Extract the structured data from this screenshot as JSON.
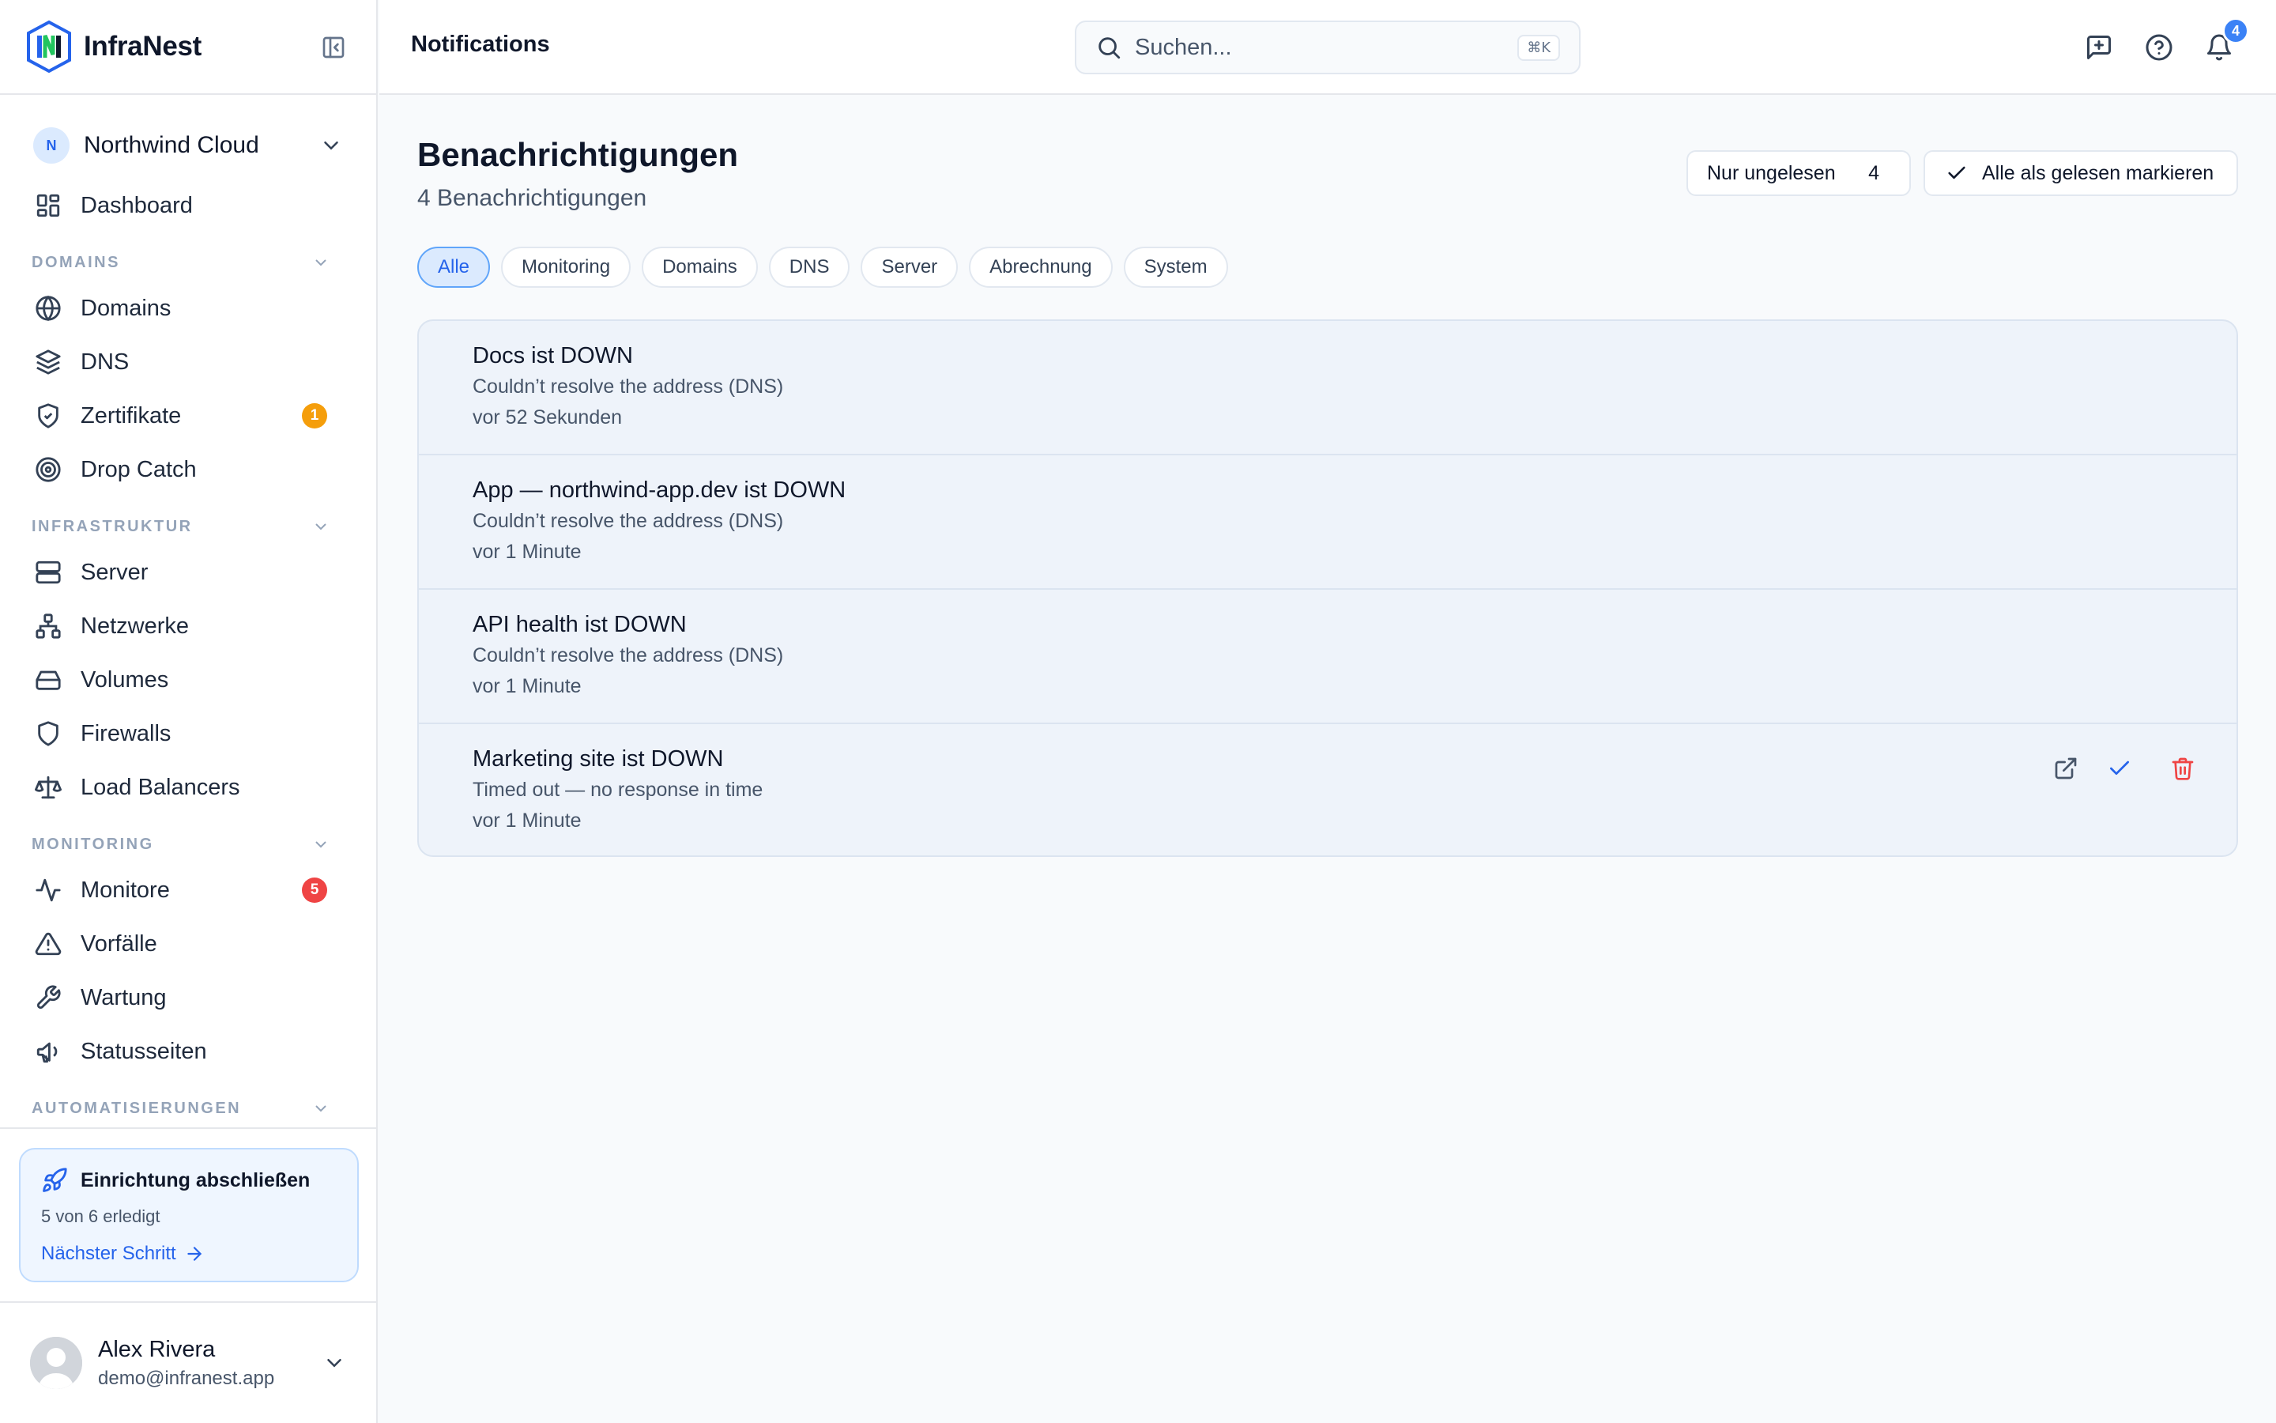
{
  "brand": {
    "name": "InfraNest"
  },
  "workspace": {
    "initial": "N",
    "name": "Northwind Cloud"
  },
  "nav": {
    "dashboard": "Dashboard",
    "sections": {
      "domains": "DOMAINS",
      "infrastructure": "INFRASTRUKTUR",
      "monitoring": "MONITORING",
      "automation": "AUTOMATISIERUNGEN"
    },
    "domains": {
      "domains": "Domains",
      "dns": "DNS",
      "certs": "Zertifikate",
      "certs_badge": "1",
      "dropcatch": "Drop Catch"
    },
    "infra": {
      "server": "Server",
      "networks": "Netzwerke",
      "volumes": "Volumes",
      "firewalls": "Firewalls",
      "lb": "Load Balancers"
    },
    "monitoring": {
      "monitors": "Monitore",
      "monitors_badge": "5",
      "incidents": "Vorfälle",
      "maintenance": "Wartung",
      "statuspages": "Statusseiten"
    }
  },
  "setup": {
    "title": "Einrichtung abschließen",
    "progress": "5 von 6 erledigt",
    "next": "Nächster Schritt"
  },
  "user": {
    "name": "Alex Rivera",
    "email": "demo@infranest.app"
  },
  "topbar": {
    "title": "Notifications",
    "search_placeholder": "Suchen...",
    "search_shortcut": "⌘K",
    "bell_count": "4"
  },
  "main": {
    "title": "Benachrichtigungen",
    "subtitle": "4 Benachrichtigungen",
    "unread_label": "Nur ungelesen",
    "unread_count": "4",
    "mark_all": "Alle als gelesen markieren",
    "filters": [
      "Alle",
      "Monitoring",
      "Domains",
      "DNS",
      "Server",
      "Abrechnung",
      "System"
    ],
    "notifications": [
      {
        "title": "Docs ist DOWN",
        "message": "Couldn’t resolve the address (DNS)",
        "time": "vor 52 Sekunden"
      },
      {
        "title": "App — northwind-app.dev ist DOWN",
        "message": "Couldn’t resolve the address (DNS)",
        "time": "vor 1 Minute"
      },
      {
        "title": "API health ist DOWN",
        "message": "Couldn’t resolve the address (DNS)",
        "time": "vor 1 Minute"
      },
      {
        "title": "Marketing site ist DOWN",
        "message": "Timed out — no response in time",
        "time": "vor 1 Minute"
      }
    ]
  },
  "colors": {
    "accent": "#2563eb",
    "badge_warning": "#f59e0b",
    "badge_danger": "#ef4444",
    "delete": "#ef4444"
  }
}
